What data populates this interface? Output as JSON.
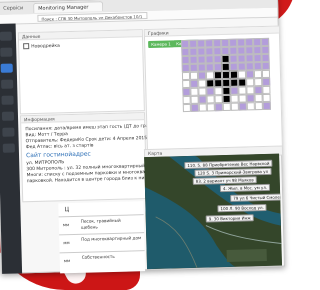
{
  "browser": {
    "back_label": "Сервіси",
    "tab_title": "Monitoring Manager",
    "url": "Поиск : СПб 30 Митрополь ул Декабристов 10/1"
  },
  "panels": {
    "device": {
      "header": "Данные",
      "title": "Новодрейка"
    },
    "info": {
      "header": "Информация",
      "lines": [
        "Посилання: дата/время имеш этап гость (ДТ до град 891)",
        "Вид: Мотт / Терра",
        "Отправитель: ФедериКо Срок дети: 4 Апреля 2015",
        "Фед Атлас: вісь ат. з стартів"
      ],
      "link": "Сайт гостинойадрес",
      "paragraph": [
        "ул. МИТРОПОЛЬ",
        "300 Митрополь : ул. 32 полный многоквартирный дом",
        "Многи: списку с подземным парковки и многоквартирной",
        "парковкой. Находится в центре города близ к ним вокруг"
      ]
    },
    "schedule": {
      "header": "Графики",
      "buttons": [
        "Камера 1",
        "Камера 2"
      ]
    },
    "map": {
      "header": "Карта",
      "labels": [
        "110. 5. 88 Приобретение Вес Нарвской",
        "120 S. 3 Приморский-Звягрова ул",
        "83. 2 вариант уч 98 Маяков",
        "4. Жил. в Мос. ум ул.",
        "79 ул 6 Чистый Смолев",
        "100 Л. 90 Восход ул.",
        "9. 30 Виктория Инж"
      ]
    }
  },
  "table": {
    "header": "Ц",
    "rows": [
      {
        "num": "мм",
        "a": "Песок, гравийный",
        "b": "щебень"
      },
      {
        "num": "мм",
        "a": "Под многоквартирный дом",
        "b": ""
      },
      {
        "num": "мм",
        "a": "Собственность",
        "b": ""
      }
    ]
  },
  "colors": {
    "brand_red": "#cc1616",
    "sidebar": "#2b2f35",
    "green_button": "#5cb85c",
    "grid_filled": "#b39ddb",
    "grid_dark": "#000000"
  }
}
